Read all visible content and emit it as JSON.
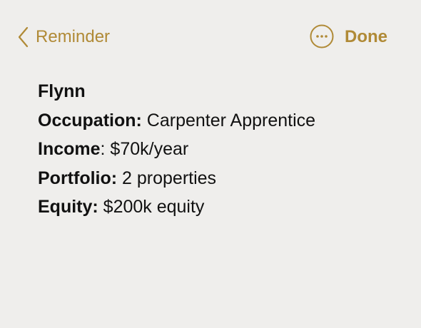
{
  "nav": {
    "back_label": "Reminder",
    "more_icon": "ellipsis-circle-icon",
    "back_icon": "chevron-left-icon",
    "done_label": "Done",
    "accent_color": "#b08a36"
  },
  "note": {
    "title": "Flynn",
    "fields": [
      {
        "label": "Occupation:",
        "value": " Carpenter Apprentice"
      },
      {
        "label": "Income",
        "value": ": $70k/year"
      },
      {
        "label": "Portfolio:",
        "value": " 2 properties"
      },
      {
        "label": "Equity:",
        "value": " $200k equity"
      }
    ]
  },
  "colors": {
    "background": "#efeeec",
    "text": "#111111"
  }
}
